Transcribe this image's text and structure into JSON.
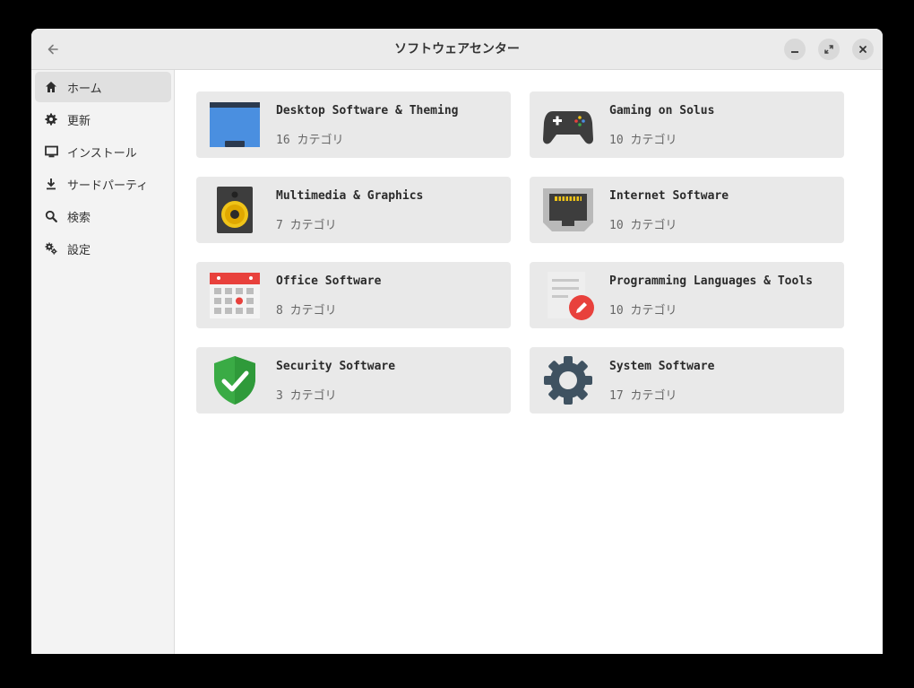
{
  "window": {
    "title": "ソフトウェアセンター",
    "back_icon": "arrow-left-icon",
    "controls": [
      "minimize-icon",
      "maximize-icon",
      "close-icon"
    ]
  },
  "sidebar": {
    "items": [
      {
        "label": "ホーム",
        "icon": "home-icon",
        "active": true
      },
      {
        "label": "更新",
        "icon": "update-gear-icon",
        "active": false
      },
      {
        "label": "インストール",
        "icon": "monitor-icon",
        "active": false
      },
      {
        "label": "サードパーティ",
        "icon": "download-icon",
        "active": false
      },
      {
        "label": "検索",
        "icon": "search-icon",
        "active": false
      },
      {
        "label": "設定",
        "icon": "settings-gears-icon",
        "active": false
      }
    ]
  },
  "categories": [
    {
      "title": "Desktop Software & Theming",
      "count": "16 カテゴリ",
      "icon": "desktop-window-icon"
    },
    {
      "title": "Gaming on Solus",
      "count": "10 カテゴリ",
      "icon": "gamepad-icon"
    },
    {
      "title": "Multimedia & Graphics",
      "count": "7 カテゴリ",
      "icon": "speaker-icon"
    },
    {
      "title": "Internet Software",
      "count": "10 カテゴリ",
      "icon": "ethernet-port-icon"
    },
    {
      "title": "Office Software",
      "count": "8 カテゴリ",
      "icon": "calendar-icon"
    },
    {
      "title": "Programming Languages & Tools",
      "count": "10 カテゴリ",
      "icon": "document-edit-icon"
    },
    {
      "title": "Security Software",
      "count": "3 カテゴリ",
      "icon": "shield-check-icon"
    },
    {
      "title": "System Software",
      "count": "17 カテゴリ",
      "icon": "gear-icon"
    }
  ],
  "colors": {
    "window_bg": "#ffffff",
    "titlebar_bg": "#ebebeb",
    "sidebar_bg": "#f3f3f3",
    "card_bg": "#e9e9e9",
    "accent_blue": "#4a8fe0",
    "accent_red": "#e8413c",
    "accent_green": "#3aab45"
  }
}
